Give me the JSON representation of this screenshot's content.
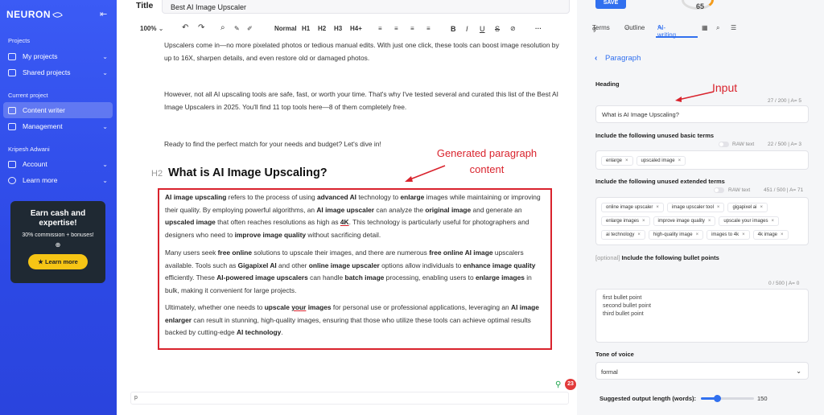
{
  "sidebar": {
    "logo": "NEURON",
    "collapse_icon": "collapse-left-icon",
    "sections": {
      "projects": "Projects",
      "current_project": "Current project",
      "user": "Kripesh Adwani"
    },
    "items": [
      {
        "label": "My projects",
        "icon": "folder-icon"
      },
      {
        "label": "Shared projects",
        "icon": "shared-folder-icon"
      },
      {
        "label": "Content writer",
        "icon": "pen-icon",
        "active": true
      },
      {
        "label": "Management",
        "icon": "list-icon"
      },
      {
        "label": "Account",
        "icon": "user-icon"
      },
      {
        "label": "Learn more",
        "icon": "info-icon"
      }
    ],
    "promo": {
      "title": "Earn cash and expertise!",
      "subtitle": "30% commission + bonuses!",
      "button": "Learn more"
    }
  },
  "editor": {
    "title_label": "Title",
    "title_value": "Best AI Image Upscaler",
    "toolbar": {
      "zoom": "100%",
      "styles": [
        "Normal",
        "H1",
        "H2",
        "H3",
        "H4+"
      ]
    },
    "paragraphs": [
      "Upscalers come in—no more pixelated photos or tedious manual edits. With just one click, these tools can boost image resolution by up to 16X, sharpen details, and even restore old or damaged photos.",
      "However, not all AI upscaling tools are safe, fast, or worth your time. That's why I've tested several and curated this list of the Best AI Image Upscalers in 2025. You'll find 11 top tools here—8 of them completely free.",
      "Ready to find the perfect match for your needs and budget? Let's dive in!"
    ],
    "heading_tag": "H2",
    "heading": "What is AI Image Upscaling?",
    "generated_paragraphs": [
      "<b>AI image upscaling</b> refers to the process of using <b>advanced AI</b> technology to <b>enlarge</b> images while maintaining or improving their quality. By employing powerful algorithms, an <b>AI image upscaler</b> can analyze the <b>original image</b> and generate an <b>upscaled image</b> that often reaches resolutions as high as <b><u>4K</u></b>. This technology is particularly useful for photographers and designers who need to <b>improve image quality</b> without sacrificing detail.",
      "Many users seek <b>free online</b> solutions to upscale their images, and there are numerous <b>free online AI image</b> upscalers available. Tools such as <b>Gigapixel AI</b> and other <b>online image upscaler</b> options allow individuals to <b>enhance image quality</b> efficiently. These <b>AI-powered image upscalers</b> can handle <b>batch image</b> processing, enabling users to <b>enlarge images</b> in bulk, making it convenient for large projects.",
      "Ultimately, whether one needs to <b>upscale <u>your</u> images</b> for personal use or professional applications, leveraging an <b>AI image enlarger</b> can result in stunning, high-quality images, ensuring that those who utilize these tools can achieve optimal results backed by cutting-edge <b>AI technology</b>."
    ],
    "annotation_generated": "Generated paragraph content",
    "status_text": "p",
    "badge_count": "23"
  },
  "panel": {
    "save_label": "SAVE",
    "score": "65",
    "tabs": [
      "Terms",
      "Outline",
      "AI-writing"
    ],
    "back_title": "Paragraph",
    "heading_label": "Heading",
    "heading_counter": "27 / 200",
    "heading_counter_a": "A= 5",
    "heading_value": "What is AI Image Upscaling?",
    "annotation_input": "Input",
    "basic_terms_label": "Include the following unused basic terms",
    "raw_text": "RAW text",
    "basic_counter": "22 / 500",
    "basic_counter_a": "A= 3",
    "basic_terms": [
      "enlarge",
      "upscaled image"
    ],
    "extended_terms_label": "Include the following unused extended terms",
    "extended_counter": "451 / 500",
    "extended_counter_a": "A= 71",
    "extended_terms": [
      "online image upscaler",
      "image upscaler tool",
      "gigapixel ai",
      "enlarge images",
      "improve image quality",
      "upscale your images",
      "ai technology",
      "high-quality image",
      "images to 4k",
      "4k image"
    ],
    "bullets_optional": "[optional]",
    "bullets_label": "Include the following bullet points",
    "bullets_counter": "0 / 500",
    "bullets_counter_a": "A= 0",
    "bullets_placeholder": "first bullet point\nsecond bullet point\nthird bullet point",
    "tone_label": "Tone of voice",
    "tone_value": "formal",
    "length_label": "Suggested output length (words):",
    "length_value": "150",
    "length_fraction": 0.3,
    "accent": "#3170ef"
  }
}
